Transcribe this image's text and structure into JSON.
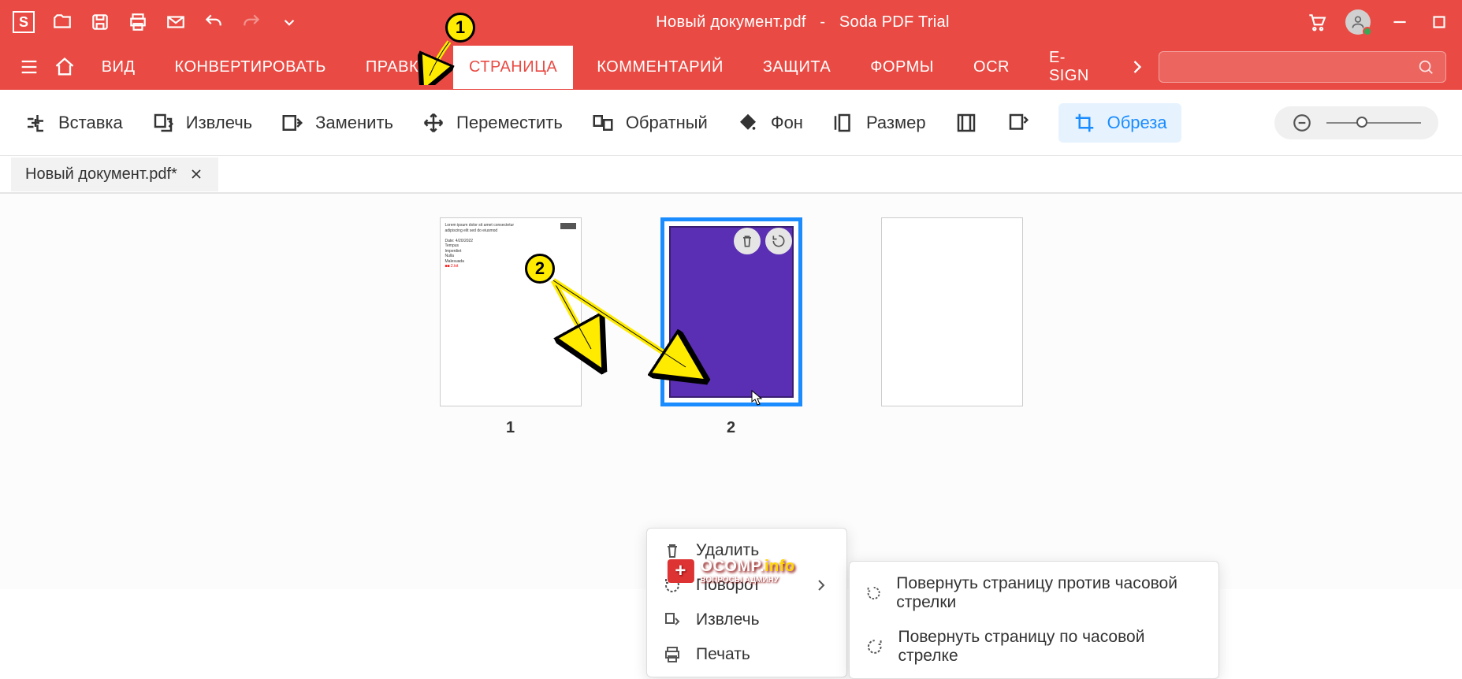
{
  "title": {
    "doc": "Новый документ.pdf",
    "sep": "-",
    "app": "Soda PDF Trial"
  },
  "nav": {
    "items": [
      "ВИД",
      "КОНВЕРТИРОВАТЬ",
      "ПРАВКА",
      "СТРАНИЦА",
      "КОММЕНТАРИЙ",
      "ЗАЩИТА",
      "ФОРМЫ",
      "OCR",
      "E-SIGN"
    ],
    "active_index": 3
  },
  "toolbar": {
    "insert": "Вставка",
    "extract": "Извлечь",
    "replace": "Заменить",
    "move": "Переместить",
    "reverse": "Обратный",
    "background": "Фон",
    "size": "Размер",
    "crop": "Обреза"
  },
  "tab": {
    "name": "Новый документ.pdf*",
    "close": "×"
  },
  "pages": {
    "p1": "1",
    "p2": "2"
  },
  "context_menu": {
    "delete": "Удалить",
    "rotate": "Поворот",
    "extract": "Извлечь",
    "print": "Печать"
  },
  "submenu": {
    "ccw": "Повернуть страницу против часовой стрелки",
    "cw": "Повернуть страницу по часовой стрелке"
  },
  "callouts": {
    "c1": "1",
    "c2": "2"
  },
  "watermark": {
    "plus": "+",
    "brand": "OCOMP",
    "dot": ".",
    "suffix": "info",
    "sub": "ВОПРОСЫ АДМИНУ"
  }
}
